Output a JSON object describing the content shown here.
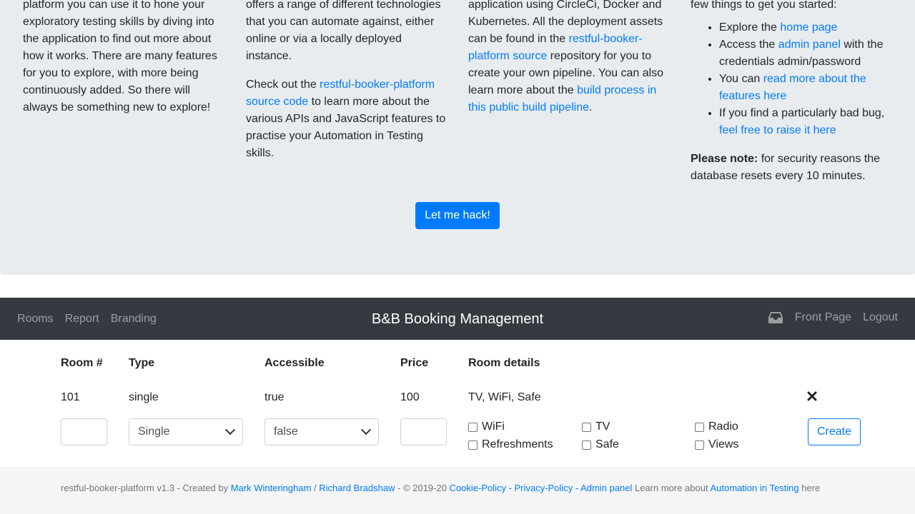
{
  "intro": {
    "col1": {
      "text": "platform you can use it to hone your exploratory testing skills by diving into the application to find out more about how it works. There are many features for you to explore, with more being continuously added. So there will always be something new to explore!"
    },
    "col2": {
      "p1": "offers a range of different technologies that you can automate against, either online or via a locally deployed instance.",
      "p2_pre": "Check out the ",
      "p2_link": "restful-booker-platform source code",
      "p2_post": " to learn more about the various APIs and JavaScript features to practise your Automation in Testing skills."
    },
    "col3": {
      "pre": "application using CircleCi, Docker and Kubernetes. All the deployment assets can be found in the ",
      "link1": "restful-booker-platform source",
      "mid": " repository for you to create your own pipeline. You can also learn more about the ",
      "link2": "build process in this public build pipeline",
      "post": "."
    },
    "col4": {
      "intro": "few things to get you started:",
      "items": [
        {
          "pre": "Explore the ",
          "link": "home page",
          "post": ""
        },
        {
          "pre": "Access the ",
          "link": "admin panel",
          "post": " with the credentials admin/password"
        },
        {
          "pre": "You can ",
          "link": "read more about the features here",
          "post": ""
        },
        {
          "pre": "If you find a particularly bad bug, ",
          "link": "feel free to raise it here",
          "post": ""
        }
      ],
      "note_bold": "Please note:",
      "note_text": " for security reasons the database resets every 10 minutes."
    },
    "hack_button": "Let me hack!"
  },
  "navbar": {
    "links": [
      "Rooms",
      "Report",
      "Branding"
    ],
    "title": "B&B Booking Management",
    "front_page": "Front Page",
    "logout": "Logout",
    "inbox_icon": "inbox-icon"
  },
  "table": {
    "headers": {
      "room": "Room #",
      "type": "Type",
      "accessible": "Accessible",
      "price": "Price",
      "details": "Room details"
    },
    "row": {
      "room": "101",
      "type": "single",
      "accessible": "true",
      "price": "100",
      "details": "TV, WiFi, Safe",
      "delete_icon": "close-icon"
    },
    "form": {
      "room_value": "",
      "type_selected": "Single",
      "accessible_selected": "false",
      "price_value": "",
      "features": [
        "WiFi",
        "TV",
        "Radio",
        "Refreshments",
        "Safe",
        "Views"
      ],
      "create_label": "Create"
    }
  },
  "footer": {
    "prefix": "restful-booker-platform v1.3 - Created by ",
    "author1": "Mark Winteringham",
    "sep1": " / ",
    "author2": "Richard Bradshaw",
    "copy": " - © 2019-20 ",
    "cookie": "Cookie-Policy",
    "dash1": " - ",
    "privacy": "Privacy-Policy",
    "dash2": " - ",
    "admin": "Admin panel",
    "learn_pre": " Learn more about ",
    "ait": "Automation in Testing",
    "learn_post": " here"
  }
}
